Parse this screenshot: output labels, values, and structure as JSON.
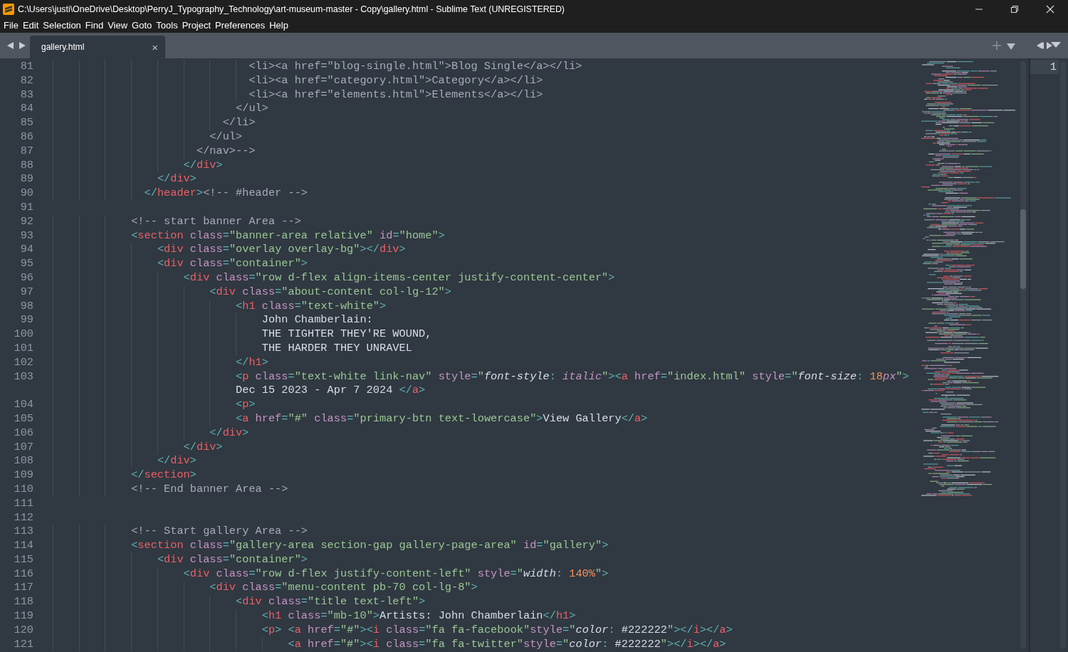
{
  "window": {
    "title": "C:\\Users\\justi\\OneDrive\\Desktop\\PerryJ_Typography_Technology\\art-museum-master - Copy\\gallery.html - Sublime Text (UNREGISTERED)"
  },
  "menu": [
    "File",
    "Edit",
    "Selection",
    "Find",
    "View",
    "Goto",
    "Tools",
    "Project",
    "Preferences",
    "Help"
  ],
  "tabs": [
    {
      "label": "gallery.html",
      "close": "×",
      "selected": true
    }
  ],
  "lines": [
    {
      "number": "81",
      "tokens": [
        {
          "kind": "c",
          "text": "                              <li><a href=\"blog-single.html\">Blog Single</a></li>"
        }
      ]
    },
    {
      "number": "82",
      "tokens": [
        {
          "kind": "c",
          "text": "                              <li><a href=\"category.html\">Category</a></li>"
        }
      ]
    },
    {
      "number": "83",
      "tokens": [
        {
          "kind": "c",
          "text": "                              <li><a href=\"elements.html\">Elements</a></li>"
        }
      ]
    },
    {
      "number": "84",
      "tokens": [
        {
          "kind": "c",
          "text": "                            </ul>"
        }
      ]
    },
    {
      "number": "85",
      "tokens": [
        {
          "kind": "c",
          "text": "                          </li>"
        }
      ]
    },
    {
      "number": "86",
      "tokens": [
        {
          "kind": "c",
          "text": "                        </ul>"
        }
      ]
    },
    {
      "number": "87",
      "tokens": [
        {
          "kind": "c",
          "text": "                      </nav>-->"
        }
      ]
    },
    {
      "number": "88",
      "tokens": [
        {
          "kind": "p",
          "text": "                    </"
        },
        {
          "kind": "t",
          "text": "div"
        },
        {
          "kind": "p",
          "text": ">"
        }
      ]
    },
    {
      "number": "89",
      "tokens": [
        {
          "kind": "p",
          "text": "                </"
        },
        {
          "kind": "t",
          "text": "div"
        },
        {
          "kind": "p",
          "text": ">"
        }
      ]
    },
    {
      "number": "90",
      "tokens": [
        {
          "kind": "p",
          "text": "              </"
        },
        {
          "kind": "t",
          "text": "header"
        },
        {
          "kind": "p",
          "text": ">"
        },
        {
          "kind": "c",
          "text": "<!-- #header -->"
        }
      ]
    },
    {
      "number": "91"
    },
    {
      "number": "92",
      "tokens": [
        {
          "kind": "c",
          "text": "            <!-- start banner Area -->"
        }
      ]
    },
    {
      "number": "93",
      "tokens": [
        {
          "kind": "p",
          "text": "            <"
        },
        {
          "kind": "t",
          "text": "section"
        },
        {
          "kind": "a",
          "text": " class"
        },
        {
          "kind": "p",
          "text": "="
        },
        {
          "kind": "s",
          "text": "\"banner-area relative\""
        },
        {
          "kind": "a",
          "text": " id"
        },
        {
          "kind": "p",
          "text": "="
        },
        {
          "kind": "s",
          "text": "\"home\""
        },
        {
          "kind": "p",
          "text": ">"
        }
      ]
    },
    {
      "number": "94",
      "tokens": [
        {
          "kind": "p",
          "text": "                <"
        },
        {
          "kind": "t",
          "text": "div"
        },
        {
          "kind": "a",
          "text": " class"
        },
        {
          "kind": "p",
          "text": "="
        },
        {
          "kind": "s",
          "text": "\"overlay overlay-bg\""
        },
        {
          "kind": "p",
          "text": "></"
        },
        {
          "kind": "t",
          "text": "div"
        },
        {
          "kind": "p",
          "text": ">"
        }
      ]
    },
    {
      "number": "95",
      "tokens": [
        {
          "kind": "p",
          "text": "                <"
        },
        {
          "kind": "t",
          "text": "div"
        },
        {
          "kind": "a",
          "text": " class"
        },
        {
          "kind": "p",
          "text": "="
        },
        {
          "kind": "s",
          "text": "\"container\""
        },
        {
          "kind": "p",
          "text": ">"
        }
      ]
    },
    {
      "number": "96",
      "tokens": [
        {
          "kind": "p",
          "text": "                    <"
        },
        {
          "kind": "t",
          "text": "div"
        },
        {
          "kind": "a",
          "text": " class"
        },
        {
          "kind": "p",
          "text": "="
        },
        {
          "kind": "s",
          "text": "\"row d-flex align-items-center justify-content-center\""
        },
        {
          "kind": "p",
          "text": ">"
        }
      ]
    },
    {
      "number": "97",
      "tokens": [
        {
          "kind": "p",
          "text": "                        <"
        },
        {
          "kind": "t",
          "text": "div"
        },
        {
          "kind": "a",
          "text": " class"
        },
        {
          "kind": "p",
          "text": "="
        },
        {
          "kind": "s",
          "text": "\"about-content col-lg-12\""
        },
        {
          "kind": "p",
          "text": ">"
        }
      ]
    },
    {
      "number": "98",
      "tokens": [
        {
          "kind": "p",
          "text": "                            <"
        },
        {
          "kind": "t",
          "text": "h1"
        },
        {
          "kind": "a",
          "text": " class"
        },
        {
          "kind": "p",
          "text": "="
        },
        {
          "kind": "s",
          "text": "\"text-white\""
        },
        {
          "kind": "p",
          "text": ">"
        }
      ]
    },
    {
      "number": "99",
      "tokens": [
        {
          "kind": "x",
          "text": "                                John Chamberlain:"
        }
      ]
    },
    {
      "number": "100",
      "tokens": [
        {
          "kind": "x",
          "text": "                                THE TIGHTER THEY'RE WOUND,"
        }
      ]
    },
    {
      "number": "101",
      "tokens": [
        {
          "kind": "x",
          "text": "                                THE HARDER THEY UNRAVEL"
        }
      ]
    },
    {
      "number": "102",
      "tokens": [
        {
          "kind": "p",
          "text": "                            </"
        },
        {
          "kind": "t",
          "text": "h1"
        },
        {
          "kind": "p",
          "text": ">"
        }
      ]
    },
    {
      "number": "103",
      "tokens": [
        {
          "kind": "p",
          "text": "                            <"
        },
        {
          "kind": "t",
          "text": "p"
        },
        {
          "kind": "a",
          "text": " class"
        },
        {
          "kind": "p",
          "text": "="
        },
        {
          "kind": "s",
          "text": "\"text-white link-nav\""
        },
        {
          "kind": "a",
          "text": " style"
        },
        {
          "kind": "p",
          "text": "="
        },
        {
          "kind": "s",
          "text": "\""
        },
        {
          "kind": "k",
          "text": "font-style"
        },
        {
          "kind": "p",
          "text": ":"
        },
        {
          "kind": "v",
          "text": " italic"
        },
        {
          "kind": "s",
          "text": "\""
        },
        {
          "kind": "p",
          "text": "><"
        },
        {
          "kind": "t",
          "text": "a"
        },
        {
          "kind": "a",
          "text": " href"
        },
        {
          "kind": "p",
          "text": "="
        },
        {
          "kind": "s",
          "text": "\"index.html\""
        },
        {
          "kind": "a",
          "text": " style"
        },
        {
          "kind": "p",
          "text": "="
        },
        {
          "kind": "s",
          "text": "\""
        },
        {
          "kind": "k",
          "text": "font-size"
        },
        {
          "kind": "p",
          "text": ":"
        },
        {
          "kind": "n",
          "text": " 18"
        },
        {
          "kind": "v",
          "text": "px"
        },
        {
          "kind": "s",
          "text": "\""
        },
        {
          "kind": "p",
          "text": ">"
        }
      ],
      "wrapped": [
        {
          "kind": "x",
          "text": "                            Dec 15 2023 - Apr 7 2024 "
        },
        {
          "kind": "p",
          "text": "</"
        },
        {
          "kind": "t",
          "text": "a"
        },
        {
          "kind": "p",
          "text": ">"
        }
      ]
    },
    {
      "number": "104",
      "tokens": [
        {
          "kind": "p",
          "text": "                            <"
        },
        {
          "kind": "t",
          "text": "p"
        },
        {
          "kind": "p",
          "text": ">"
        }
      ]
    },
    {
      "number": "105",
      "tokens": [
        {
          "kind": "p",
          "text": "                            <"
        },
        {
          "kind": "t",
          "text": "a"
        },
        {
          "kind": "a",
          "text": " href"
        },
        {
          "kind": "p",
          "text": "="
        },
        {
          "kind": "s",
          "text": "\"#\""
        },
        {
          "kind": "a",
          "text": " class"
        },
        {
          "kind": "p",
          "text": "="
        },
        {
          "kind": "s",
          "text": "\"primary-btn text-lowercase\""
        },
        {
          "kind": "p",
          "text": ">"
        },
        {
          "kind": "x",
          "text": "View Gallery"
        },
        {
          "kind": "p",
          "text": "</"
        },
        {
          "kind": "t",
          "text": "a"
        },
        {
          "kind": "p",
          "text": ">"
        }
      ]
    },
    {
      "number": "106",
      "tokens": [
        {
          "kind": "p",
          "text": "                        </"
        },
        {
          "kind": "t",
          "text": "div"
        },
        {
          "kind": "p",
          "text": ">"
        }
      ]
    },
    {
      "number": "107",
      "tokens": [
        {
          "kind": "p",
          "text": "                    </"
        },
        {
          "kind": "t",
          "text": "div"
        },
        {
          "kind": "p",
          "text": ">"
        }
      ]
    },
    {
      "number": "108",
      "tokens": [
        {
          "kind": "p",
          "text": "                </"
        },
        {
          "kind": "t",
          "text": "div"
        },
        {
          "kind": "p",
          "text": ">"
        }
      ]
    },
    {
      "number": "109",
      "tokens": [
        {
          "kind": "p",
          "text": "            </"
        },
        {
          "kind": "t",
          "text": "section"
        },
        {
          "kind": "p",
          "text": ">"
        }
      ]
    },
    {
      "number": "110",
      "tokens": [
        {
          "kind": "c",
          "text": "            <!-- End banner Area -->"
        }
      ]
    },
    {
      "number": "111"
    },
    {
      "number": "112"
    },
    {
      "number": "113",
      "tokens": [
        {
          "kind": "c",
          "text": "            <!-- Start gallery Area -->"
        }
      ]
    },
    {
      "number": "114",
      "tokens": [
        {
          "kind": "p",
          "text": "            <"
        },
        {
          "kind": "t",
          "text": "section"
        },
        {
          "kind": "a",
          "text": " class"
        },
        {
          "kind": "p",
          "text": "="
        },
        {
          "kind": "s",
          "text": "\"gallery-area section-gap gallery-page-area\""
        },
        {
          "kind": "a",
          "text": " id"
        },
        {
          "kind": "p",
          "text": "="
        },
        {
          "kind": "s",
          "text": "\"gallery\""
        },
        {
          "kind": "p",
          "text": ">"
        }
      ]
    },
    {
      "number": "115",
      "tokens": [
        {
          "kind": "p",
          "text": "                <"
        },
        {
          "kind": "t",
          "text": "div"
        },
        {
          "kind": "a",
          "text": " class"
        },
        {
          "kind": "p",
          "text": "="
        },
        {
          "kind": "s",
          "text": "\"container\""
        },
        {
          "kind": "p",
          "text": ">"
        }
      ]
    },
    {
      "number": "116",
      "tokens": [
        {
          "kind": "p",
          "text": "                    <"
        },
        {
          "kind": "t",
          "text": "div"
        },
        {
          "kind": "a",
          "text": " class"
        },
        {
          "kind": "p",
          "text": "="
        },
        {
          "kind": "s",
          "text": "\"row d-flex justify-content-left\""
        },
        {
          "kind": "a",
          "text": " style"
        },
        {
          "kind": "p",
          "text": "="
        },
        {
          "kind": "s",
          "text": "\""
        },
        {
          "kind": "k",
          "text": "width"
        },
        {
          "kind": "p",
          "text": ":"
        },
        {
          "kind": "n",
          "text": " 140%"
        },
        {
          "kind": "s",
          "text": "\""
        },
        {
          "kind": "p",
          "text": ">"
        }
      ]
    },
    {
      "number": "117",
      "tokens": [
        {
          "kind": "p",
          "text": "                        <"
        },
        {
          "kind": "t",
          "text": "div"
        },
        {
          "kind": "a",
          "text": " class"
        },
        {
          "kind": "p",
          "text": "="
        },
        {
          "kind": "s",
          "text": "\"menu-content pb-70 col-lg-8\""
        },
        {
          "kind": "p",
          "text": ">"
        }
      ]
    },
    {
      "number": "118",
      "tokens": [
        {
          "kind": "p",
          "text": "                            <"
        },
        {
          "kind": "t",
          "text": "div"
        },
        {
          "kind": "a",
          "text": " class"
        },
        {
          "kind": "p",
          "text": "="
        },
        {
          "kind": "s",
          "text": "\"title text-left\""
        },
        {
          "kind": "p",
          "text": ">"
        }
      ]
    },
    {
      "number": "119",
      "tokens": [
        {
          "kind": "p",
          "text": "                                <"
        },
        {
          "kind": "t",
          "text": "h1"
        },
        {
          "kind": "a",
          "text": " class"
        },
        {
          "kind": "p",
          "text": "="
        },
        {
          "kind": "s",
          "text": "\"mb-10\""
        },
        {
          "kind": "p",
          "text": ">"
        },
        {
          "kind": "x",
          "text": "Artists: John Chamberlain"
        },
        {
          "kind": "p",
          "text": "</"
        },
        {
          "kind": "t",
          "text": "h1"
        },
        {
          "kind": "p",
          "text": ">"
        }
      ]
    },
    {
      "number": "120",
      "tokens": [
        {
          "kind": "p",
          "text": "                                <"
        },
        {
          "kind": "t",
          "text": "p"
        },
        {
          "kind": "p",
          "text": ">"
        },
        {
          "kind": "p",
          "text": " <"
        },
        {
          "kind": "t",
          "text": "a"
        },
        {
          "kind": "a",
          "text": " href"
        },
        {
          "kind": "p",
          "text": "="
        },
        {
          "kind": "s",
          "text": "\"#\""
        },
        {
          "kind": "p",
          "text": "><"
        },
        {
          "kind": "t",
          "text": "i"
        },
        {
          "kind": "a",
          "text": " class"
        },
        {
          "kind": "p",
          "text": "="
        },
        {
          "kind": "s",
          "text": "\"fa fa-facebook\""
        },
        {
          "kind": "a",
          "text": "style"
        },
        {
          "kind": "p",
          "text": "="
        },
        {
          "kind": "s",
          "text": "\""
        },
        {
          "kind": "k",
          "text": "color"
        },
        {
          "kind": "p",
          "text": ":"
        },
        {
          "kind": "x",
          "text": " #222222"
        },
        {
          "kind": "s",
          "text": "\""
        },
        {
          "kind": "p",
          "text": "></"
        },
        {
          "kind": "t",
          "text": "i"
        },
        {
          "kind": "p",
          "text": "></"
        },
        {
          "kind": "t",
          "text": "a"
        },
        {
          "kind": "p",
          "text": ">"
        }
      ]
    },
    {
      "number": "121",
      "tokens": [
        {
          "kind": "p",
          "text": "                                    <"
        },
        {
          "kind": "t",
          "text": "a"
        },
        {
          "kind": "a",
          "text": " href"
        },
        {
          "kind": "p",
          "text": "="
        },
        {
          "kind": "s",
          "text": "\"#\""
        },
        {
          "kind": "p",
          "text": "><"
        },
        {
          "kind": "t",
          "text": "i"
        },
        {
          "kind": "a",
          "text": " class"
        },
        {
          "kind": "p",
          "text": "="
        },
        {
          "kind": "s",
          "text": "\"fa fa-twitter\""
        },
        {
          "kind": "a",
          "text": "style"
        },
        {
          "kind": "p",
          "text": "="
        },
        {
          "kind": "s",
          "text": "\""
        },
        {
          "kind": "k",
          "text": "color"
        },
        {
          "kind": "p",
          "text": ":"
        },
        {
          "kind": "x",
          "text": " #222222"
        },
        {
          "kind": "s",
          "text": "\""
        },
        {
          "kind": "p",
          "text": "></"
        },
        {
          "kind": "t",
          "text": "i"
        },
        {
          "kind": "p",
          "text": "></"
        },
        {
          "kind": "t",
          "text": "a"
        },
        {
          "kind": "p",
          "text": ">"
        }
      ]
    }
  ],
  "second_pane": {
    "line_number": "1"
  }
}
